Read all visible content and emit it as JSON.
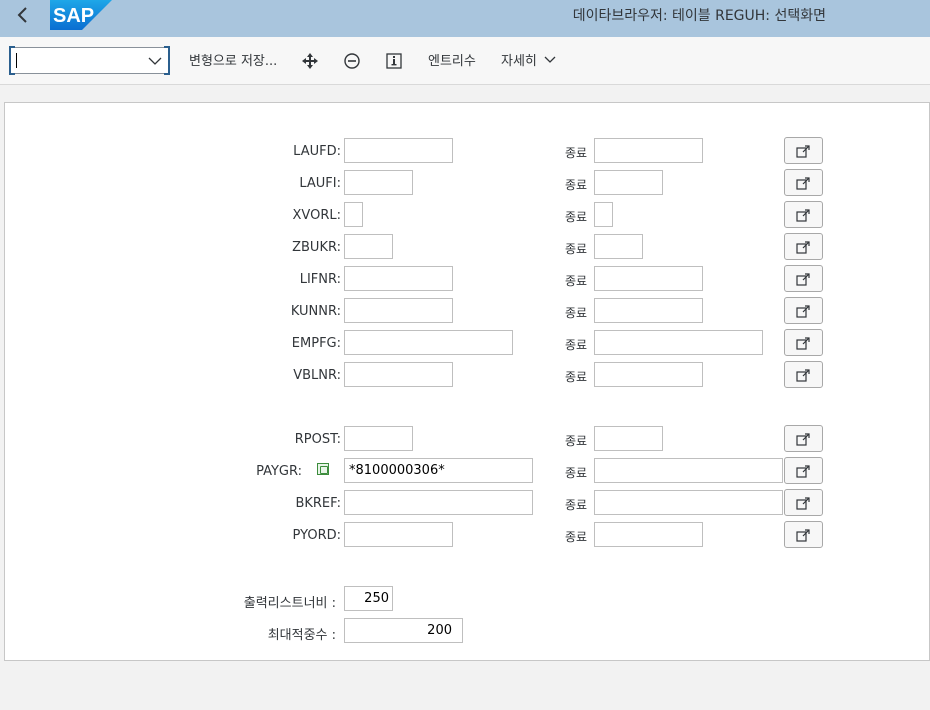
{
  "window": {
    "title": "데이타브라우저: 테이블 REGUH: 선택화면",
    "logo_text": "SAP"
  },
  "toolbar": {
    "command_value": "",
    "save_variant_label": "변형으로 저장...",
    "entry_count_label": "엔트리수",
    "more_label": "자세히"
  },
  "selection": {
    "to_label": "종료",
    "rows_group1": [
      {
        "name": "LAUFD:",
        "from": "",
        "to": ""
      },
      {
        "name": "LAUFI:",
        "from": "",
        "to": ""
      },
      {
        "name": "XVORL:",
        "from": "",
        "to": ""
      },
      {
        "name": "ZBUKR:",
        "from": "",
        "to": ""
      },
      {
        "name": "LIFNR:",
        "from": "",
        "to": ""
      },
      {
        "name": "KUNNR:",
        "from": "",
        "to": ""
      },
      {
        "name": "EMPFG:",
        "from": "",
        "to": ""
      },
      {
        "name": "VBLNR:",
        "from": "",
        "to": ""
      }
    ],
    "rows_group2": [
      {
        "name": "RPOST:",
        "from": "",
        "to": ""
      },
      {
        "name": "PAYGR:",
        "from": "*8100000306*",
        "to": ""
      },
      {
        "name": "BKREF:",
        "from": "",
        "to": ""
      },
      {
        "name": "PYORD:",
        "from": "",
        "to": ""
      }
    ]
  },
  "settings": {
    "output_width_label": "출력리스트너비 :",
    "output_width_value": "250",
    "max_hits_label": "최대적중수 :",
    "max_hits_value": "200"
  },
  "colors": {
    "shellbar": "#a9c5dd",
    "selected_option_icon": "#3c8c3c"
  }
}
